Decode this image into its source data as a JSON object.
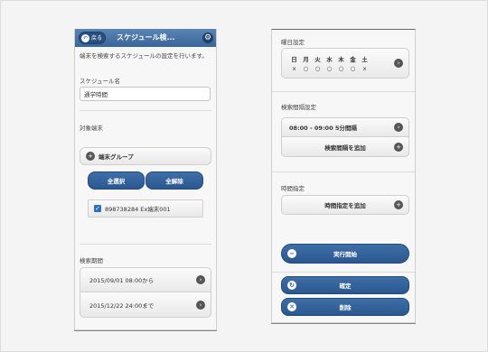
{
  "left": {
    "header": {
      "back_label": "戻る",
      "back_icon": "back-arrow-icon",
      "title": "スケジュール検...",
      "settings_icon": "gear-icon"
    },
    "description": "端末を検索するスケジュールの設定を行います。",
    "schedule_name_label": "スケジュール名",
    "schedule_name_value": "通学時間",
    "target_label": "対象端末",
    "group_button_label": "端末グループ",
    "select_all_label": "全選択",
    "deselect_all_label": "全解除",
    "device_item_label": "898738284 Ex端末001",
    "search_period_label": "検索期間",
    "period_start": "2015/09/01 08:00から",
    "period_end": "2015/12/22 24:00まで"
  },
  "right": {
    "weekday_label": "曜日設定",
    "days": [
      "日",
      "月",
      "火",
      "水",
      "木",
      "金",
      "土"
    ],
    "day_marks": [
      "x",
      "○",
      "○",
      "○",
      "○",
      "○",
      "x"
    ],
    "interval_label": "検索間隔設定",
    "interval_value": "08:00 - 09:00 5分間隔",
    "add_interval_label": "検索間隔を追加",
    "time_label": "時間指定",
    "add_time_label": "時間指定を追加",
    "start_label": "実行開始",
    "confirm_label": "確定",
    "delete_label": "削除"
  },
  "colors": {
    "primary": "#2f5d94",
    "header": "#4a77ab",
    "checkbox": "#2e6fb8"
  }
}
